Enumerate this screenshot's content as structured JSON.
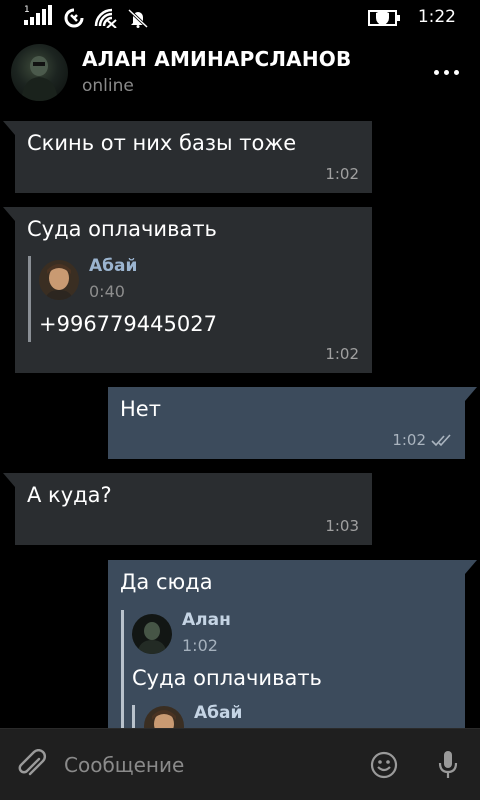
{
  "status_bar": {
    "sim_label": "1",
    "time": "1:22"
  },
  "header": {
    "name": "АЛАН АМИНАРСЛАНОВ",
    "status": "online"
  },
  "messages": [
    {
      "direction": "in",
      "text": "Скинь от них базы тоже",
      "time": "1:02"
    },
    {
      "direction": "in",
      "text": "Суда оплачивать",
      "time": "1:02",
      "quote": {
        "name": "Абай",
        "time": "0:40",
        "text": "+996779445027"
      }
    },
    {
      "direction": "out",
      "text": "Нет",
      "time": "1:02",
      "status": "read"
    },
    {
      "direction": "in",
      "text": "А куда?",
      "time": "1:03"
    },
    {
      "direction": "out",
      "text": "Да сюда",
      "quote": {
        "name": "Алан",
        "time": "1:02",
        "text": "Суда оплачивать",
        "nested_quote": {
          "name": "Абай"
        }
      }
    }
  ],
  "input": {
    "placeholder": "Сообщение"
  },
  "colors": {
    "background": "#000000",
    "incoming_bubble": "#2a2d30",
    "outgoing_bubble": "#3c4b5c",
    "quote_name": "#9bb4cf",
    "input_bar": "#1f1f1f"
  },
  "icons": {
    "status_bar": [
      "signal-icon",
      "sync-icon",
      "wifi-icon",
      "notification-muted-icon",
      "battery-saver-icon"
    ],
    "header": [
      "more-icon"
    ],
    "input_bar": [
      "attach-icon",
      "emoji-icon",
      "microphone-icon"
    ]
  }
}
